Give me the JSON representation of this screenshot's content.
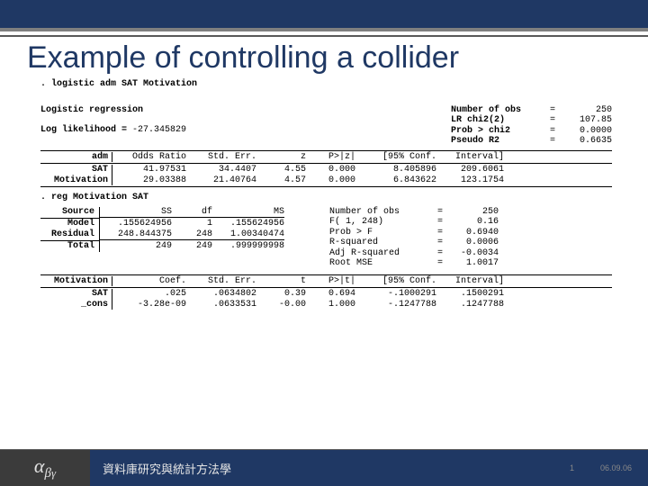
{
  "title": "Example of controlling a collider",
  "cmd_logistic": ". logistic adm SAT Motivation",
  "logit_name": "Logistic regression",
  "loglik_label": "Log likelihood = ",
  "loglik_value": "-27.345829",
  "logit_stats": [
    {
      "label": "Number of obs",
      "eq": "=",
      "val": "250"
    },
    {
      "label": "LR chi2(2)",
      "eq": "=",
      "val": "107.85"
    },
    {
      "label": "Prob > chi2",
      "eq": "=",
      "val": "0.0000"
    },
    {
      "label": "Pseudo R2",
      "eq": "=",
      "val": "0.6635"
    }
  ],
  "logit_headers": {
    "dep": "adm",
    "or": "Odds Ratio",
    "se": "Std. Err.",
    "z": "z",
    "pz": "P>|z|",
    "ci": "[95% Conf. Interval]"
  },
  "logit_rows": [
    {
      "v": "SAT",
      "or": "41.97531",
      "se": "34.4407",
      "z": "4.55",
      "p": "0.000",
      "lo": "8.405896",
      "hi": "209.6061"
    },
    {
      "v": "Motivation",
      "or": "29.03388",
      "se": "21.40764",
      "z": "4.57",
      "p": "0.000",
      "lo": "6.843622",
      "hi": "123.1754"
    }
  ],
  "cmd_reg": ". reg Motivation SAT",
  "anova_headers": {
    "src": "Source",
    "ss": "SS",
    "df": "df",
    "ms": "MS"
  },
  "anova_rows": [
    {
      "s": "Model",
      "ss": ".155624956",
      "df": "1",
      "ms": ".155624956"
    },
    {
      "s": "Residual",
      "ss": "248.844375",
      "df": "248",
      "ms": "1.00340474"
    }
  ],
  "anova_total": {
    "s": "Total",
    "ss": "249",
    "df": "249",
    "ms": ".999999998"
  },
  "reg_stats": [
    {
      "label": "Number of obs",
      "eq": "=",
      "val": "250"
    },
    {
      "label": "F(  1,   248)",
      "eq": "=",
      "val": "0.16"
    },
    {
      "label": "Prob > F",
      "eq": "=",
      "val": "0.6940"
    },
    {
      "label": "R-squared",
      "eq": "=",
      "val": "0.0006"
    },
    {
      "label": "Adj R-squared",
      "eq": "=",
      "val": "-0.0034"
    },
    {
      "label": "Root MSE",
      "eq": "=",
      "val": "1.0017"
    }
  ],
  "reg_headers": {
    "dep": "Motivation",
    "coef": "Coef.",
    "se": "Std. Err.",
    "t": "t",
    "pt": "P>|t|",
    "ci": "[95% Conf. Interval]"
  },
  "reg_rows": [
    {
      "v": "SAT",
      "c": ".025",
      "se": ".0634802",
      "t": "0.39",
      "p": "0.694",
      "lo": "-.1000291",
      "hi": ".1500291"
    },
    {
      "v": "_cons",
      "c": "-3.28e-09",
      "se": ".0633531",
      "t": "-0.00",
      "p": "1.000",
      "lo": "-.1247788",
      "hi": ".1247788"
    }
  ],
  "footer": {
    "logo_a": "α",
    "logo_b": "β",
    "logo_y": "γ",
    "text": "資料庫研究與統計方法學",
    "page": "1",
    "date": "06.09.06"
  }
}
